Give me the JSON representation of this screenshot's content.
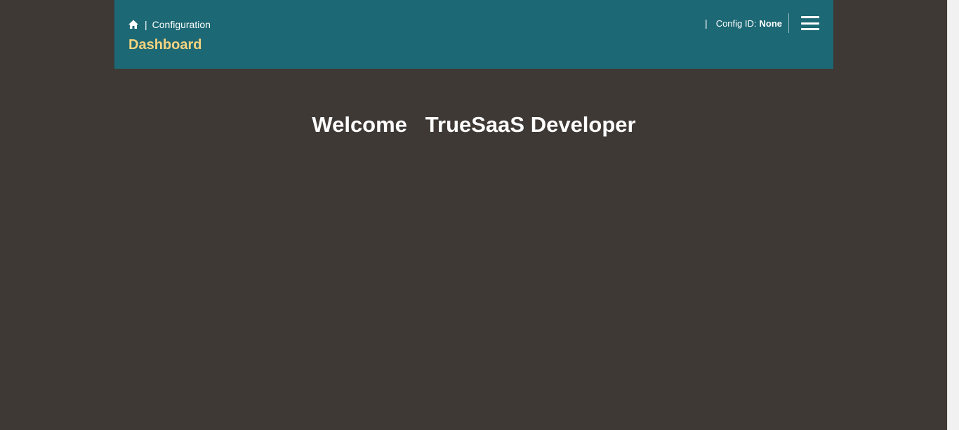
{
  "header": {
    "breadcrumb": {
      "home_icon": "home-icon",
      "separator": "|",
      "current": "Configuration"
    },
    "title": "Dashboard",
    "config": {
      "separator": "|",
      "label": "Config ID:",
      "value": "None"
    },
    "menu_icon": "hamburger-menu-icon"
  },
  "main": {
    "welcome_prefix": "Welcome",
    "user_name": "TrueSaaS Developer"
  },
  "colors": {
    "page_background": "#3f3935",
    "header_background": "#1c6874",
    "title_accent": "#f5d37f",
    "text": "#ffffff"
  }
}
